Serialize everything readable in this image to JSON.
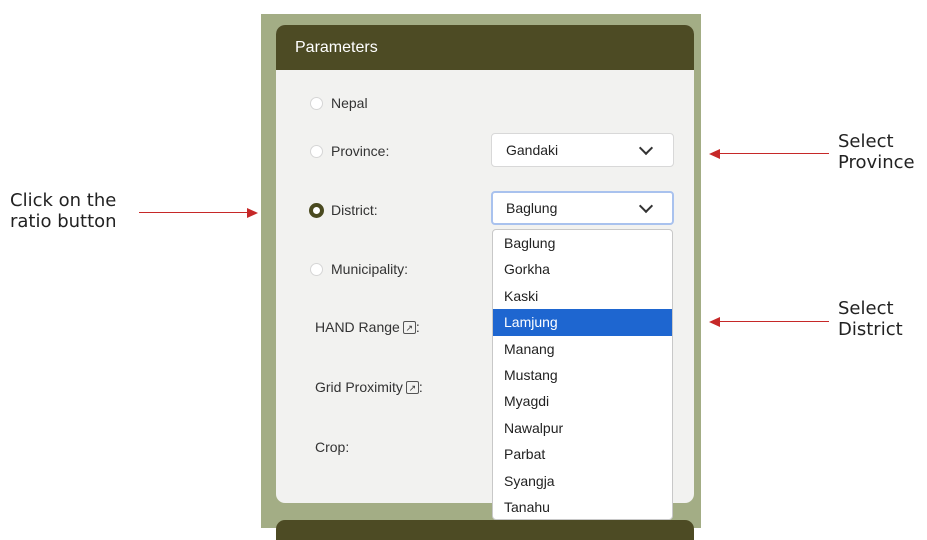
{
  "panel": {
    "title": "Parameters"
  },
  "options": {
    "nepal": "Nepal",
    "province": "Province:",
    "district": "District:",
    "municipality": "Municipality:",
    "selected": "district"
  },
  "fields": {
    "hand_range": "HAND Range",
    "grid_proximity": "Grid Proximity",
    "crop": "Crop:",
    "label_suffix": ":",
    "popout_icon_glyph": "↗"
  },
  "province_select": {
    "value": "Gandaki"
  },
  "district_select": {
    "value": "Baglung",
    "options": [
      "Baglung",
      "Gorkha",
      "Kaski",
      "Lamjung",
      "Manang",
      "Mustang",
      "Myagdi",
      "Nawalpur",
      "Parbat",
      "Syangja",
      "Tanahu"
    ],
    "highlighted": "Lamjung"
  },
  "annotations": {
    "radio_instruction": [
      "Click on the",
      "ratio button"
    ],
    "province_instruction": [
      "Select",
      "Province"
    ],
    "district_instruction": [
      "Select",
      "District"
    ]
  },
  "colors": {
    "header": "#4d4b24",
    "frame": "#a3ad85",
    "highlight": "#1e66d0",
    "arrow": "#c62828"
  }
}
